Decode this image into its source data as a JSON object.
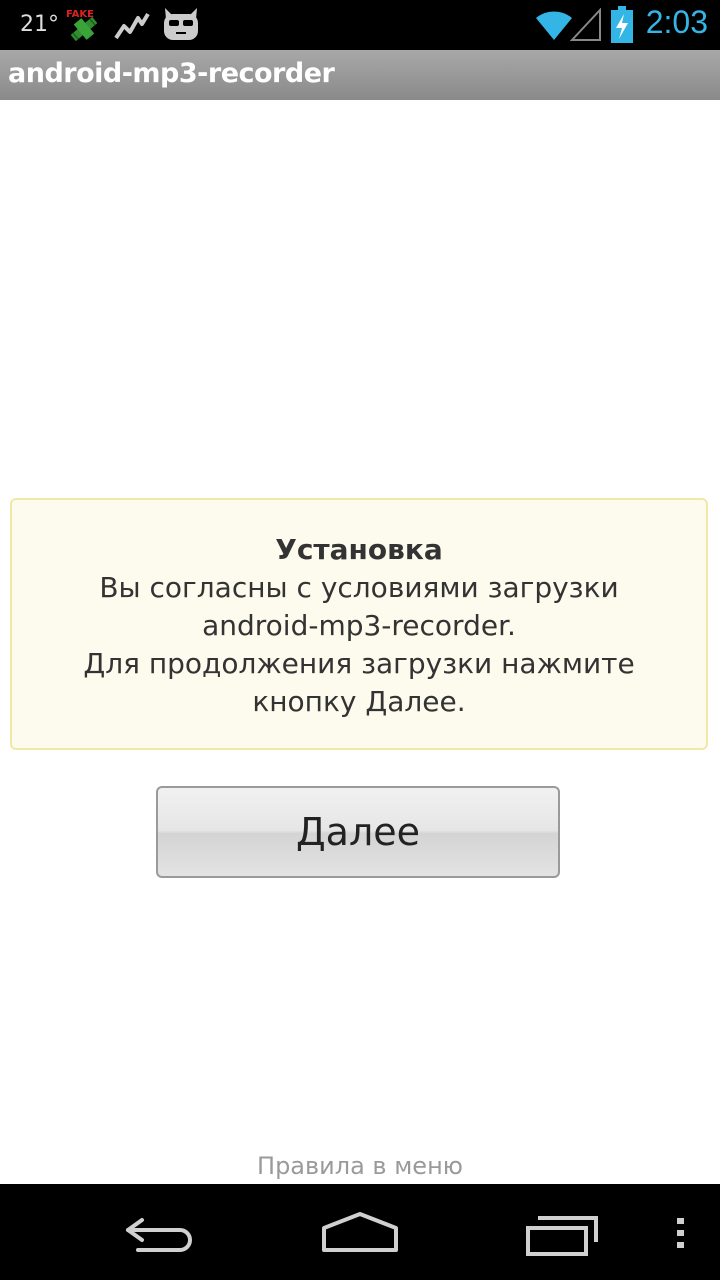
{
  "status_bar": {
    "temperature": "21°",
    "clock": "2:03",
    "icons": [
      "fake-gps-icon",
      "activity-graph-icon",
      "cyanogen-mascot-icon",
      "wifi-icon",
      "signal-icon",
      "battery-charging-icon"
    ],
    "accent_color": "#33b5e5"
  },
  "title_bar": {
    "title": "android-mp3-recorder"
  },
  "message": {
    "title": "Установка",
    "line1": "Вы согласны с условиями загрузки",
    "line2": "android-mp3-recorder.",
    "line3": "Для продолжения загрузки нажмите",
    "line4": "кнопку Далее."
  },
  "next_button": {
    "label": "Далее"
  },
  "footer": {
    "menu_hint": "Правила в меню"
  },
  "nav_bar": {
    "icons": [
      "back-icon",
      "home-icon",
      "recent-apps-icon",
      "overflow-menu-icon"
    ]
  }
}
